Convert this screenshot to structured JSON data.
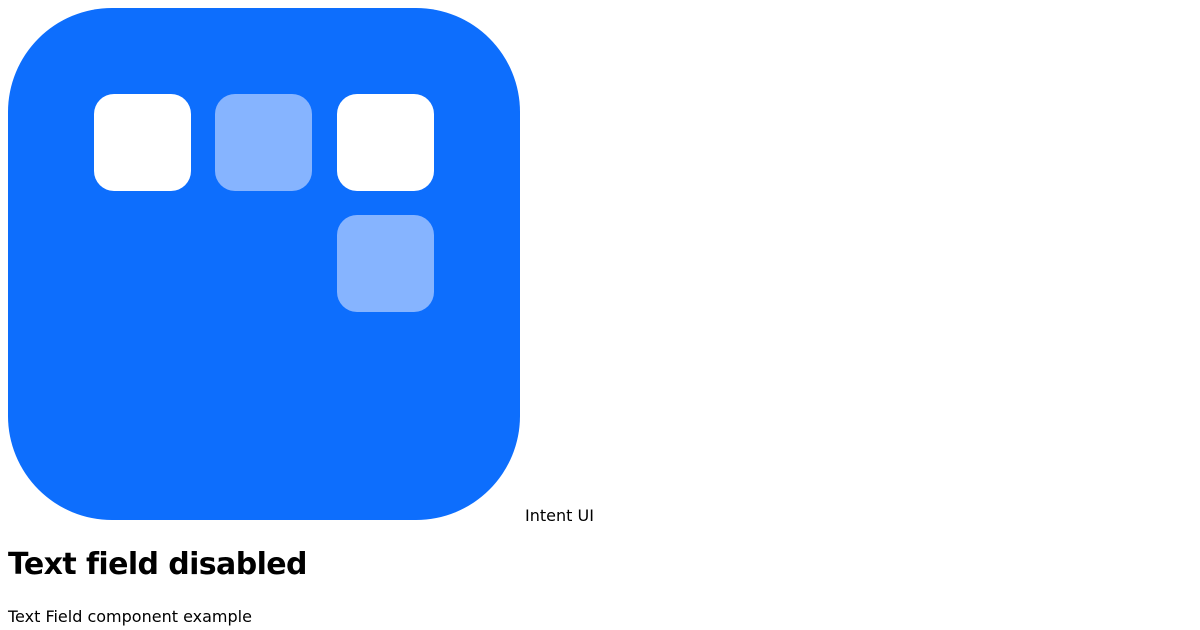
{
  "brand": {
    "name": "Intent UI",
    "logo_color": "#0d6efd",
    "tile_colors": {
      "solid": "#ffffff",
      "light": "#86b4ff"
    }
  },
  "header": {
    "title": "Text field disabled",
    "subtitle": "Text Field component example"
  }
}
